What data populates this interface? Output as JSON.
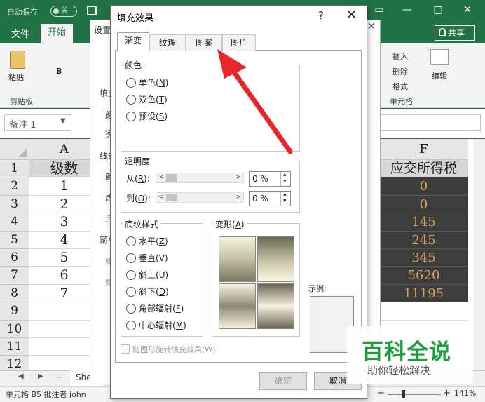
{
  "excel": {
    "autosave_label": "自动保存",
    "autosave_state": "关",
    "ribbon_tabs": {
      "file": "文件",
      "home": "开始"
    },
    "share": "共享",
    "ribbon": {
      "paste": "粘贴",
      "clipboard_group": "剪贴板",
      "insert": "插入",
      "delete": "删除",
      "format": "格式",
      "cells_group": "单元格",
      "edit": "编辑"
    },
    "namebox": "备注 1",
    "columns": {
      "a": "A",
      "f": "F"
    },
    "rows": [
      {
        "num": "1",
        "a": "级数",
        "f": "应交所得税"
      },
      {
        "num": "2",
        "a": "1",
        "f": "0"
      },
      {
        "num": "3",
        "a": "2",
        "f": "0"
      },
      {
        "num": "4",
        "a": "3",
        "f": "145"
      },
      {
        "num": "5",
        "a": "4",
        "f": "245"
      },
      {
        "num": "6",
        "a": "5",
        "f": "345"
      },
      {
        "num": "7",
        "a": "6",
        "f": "5620"
      },
      {
        "num": "8",
        "a": "7",
        "f": "11195"
      },
      {
        "num": "9",
        "a": "",
        "f": ""
      },
      {
        "num": "10",
        "a": "",
        "f": ""
      },
      {
        "num": "11",
        "a": "",
        "f": ""
      },
      {
        "num": "12",
        "a": "",
        "f": ""
      }
    ],
    "sheet_tab": "She",
    "status": "单元格 B5 批注者 john",
    "zoom": "141%"
  },
  "bg_dialog": {
    "title": "设置",
    "side_labels": [
      "填充",
      "颜",
      "透",
      "线条",
      "颜",
      "虚",
      "连",
      "箭头",
      "始",
      "始"
    ]
  },
  "dialog": {
    "title": "填充效果",
    "help": "?",
    "close": "✕",
    "tabs": [
      "渐变",
      "纹理",
      "图案",
      "图片"
    ],
    "active_tab": "渐变",
    "color_group": {
      "title": "颜色",
      "options": [
        {
          "label": "单色",
          "key": "N"
        },
        {
          "label": "双色",
          "key": "T"
        },
        {
          "label": "预设",
          "key": "S"
        }
      ]
    },
    "transparency_group": {
      "title": "透明度",
      "from_label": "从",
      "from_key": "R",
      "from_value": "0 %",
      "to_label": "到",
      "to_key": "O",
      "to_value": "0 %"
    },
    "shading_group": {
      "title": "底纹样式",
      "options": [
        {
          "label": "水平",
          "key": "Z"
        },
        {
          "label": "垂直",
          "key": "V"
        },
        {
          "label": "斜上",
          "key": "U"
        },
        {
          "label": "斜下",
          "key": "D"
        },
        {
          "label": "角部辐射",
          "key": "F"
        },
        {
          "label": "中心辐射",
          "key": "M"
        }
      ]
    },
    "variants_group": {
      "title": "变形",
      "key": "A"
    },
    "rotate_checkbox": "随图形旋转填充效果(W)",
    "sample_label": "示例:",
    "ok": "确定",
    "cancel": "取消"
  },
  "colors": {
    "excel_green": "#217346",
    "arrow_red": "#e8262a",
    "watermark_green": "#1a9e3a"
  },
  "watermark": {
    "main": "百科全说",
    "sub": "助你轻松解决"
  }
}
